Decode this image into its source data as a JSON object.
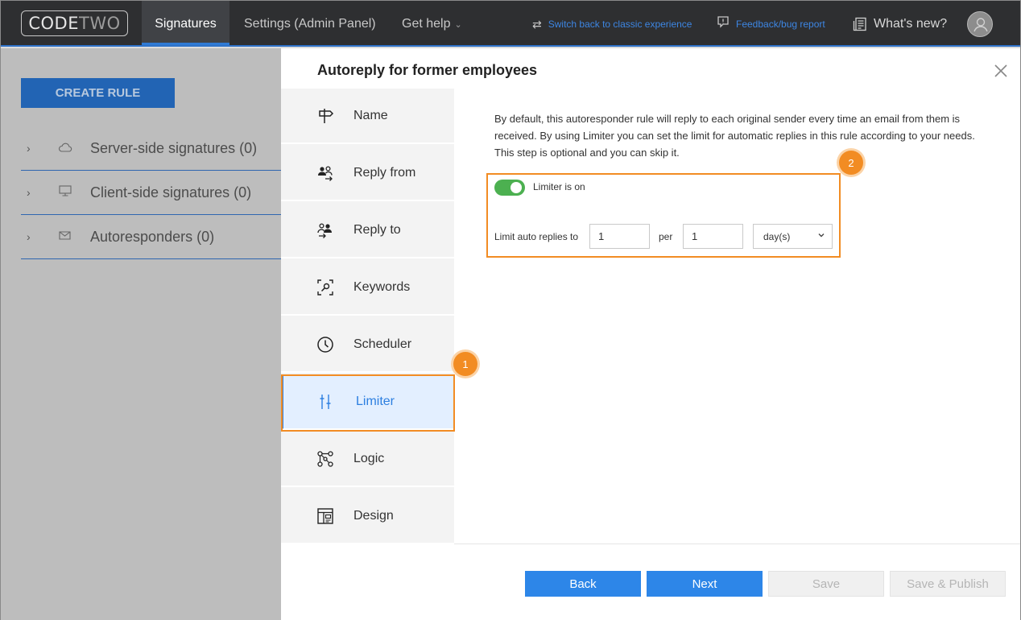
{
  "topbar": {
    "logo_main": "CODE",
    "logo_accent": "TWO",
    "nav": [
      {
        "label": "Signatures"
      },
      {
        "label": "Settings (Admin Panel)"
      },
      {
        "label": "Get help"
      }
    ],
    "switch_link": "Switch back to classic experience",
    "feedback_link": "Feedback/bug report",
    "whats_new": "What's new?"
  },
  "background": {
    "create_rule": "CREATE RULE",
    "rows": [
      {
        "label": "Server-side signatures (0)",
        "icon": "cloud-icon"
      },
      {
        "label": "Client-side signatures (0)",
        "icon": "monitor-icon"
      },
      {
        "label": "Autoresponders (0)",
        "icon": "mail-reply-icon"
      }
    ]
  },
  "modal": {
    "title": "Autoreply for former employees",
    "steps": [
      {
        "label": "Name",
        "icon": "signpost-icon"
      },
      {
        "label": "Reply from",
        "icon": "users-arrow-icon"
      },
      {
        "label": "Reply to",
        "icon": "users-arrow-icon"
      },
      {
        "label": "Keywords",
        "icon": "keyword-search-icon"
      },
      {
        "label": "Scheduler",
        "icon": "clock-icon"
      },
      {
        "label": "Limiter",
        "icon": "limiter-icon",
        "active": true
      },
      {
        "label": "Logic",
        "icon": "logic-nodes-icon"
      },
      {
        "label": "Design",
        "icon": "layout-icon"
      }
    ],
    "description": "By default, this autoresponder rule will reply to each original sender every time an email from them is received. By using Limiter you can set the limit for automatic replies in this rule according to your needs. This step is optional and you can skip it.",
    "toggle_label": "Limiter is on",
    "toggle_on": true,
    "limit_label": "Limit auto replies to",
    "limit_count": "1",
    "per_label": "per",
    "period_count": "1",
    "period_unit": "day(s)",
    "badges": [
      "1",
      "2"
    ],
    "buttons": {
      "back": "Back",
      "next": "Next",
      "save": "Save",
      "save_publish": "Save & Publish"
    }
  },
  "colors": {
    "accent": "#2d86e8",
    "highlight": "#f28c23",
    "toggle_on": "#4cb050"
  }
}
